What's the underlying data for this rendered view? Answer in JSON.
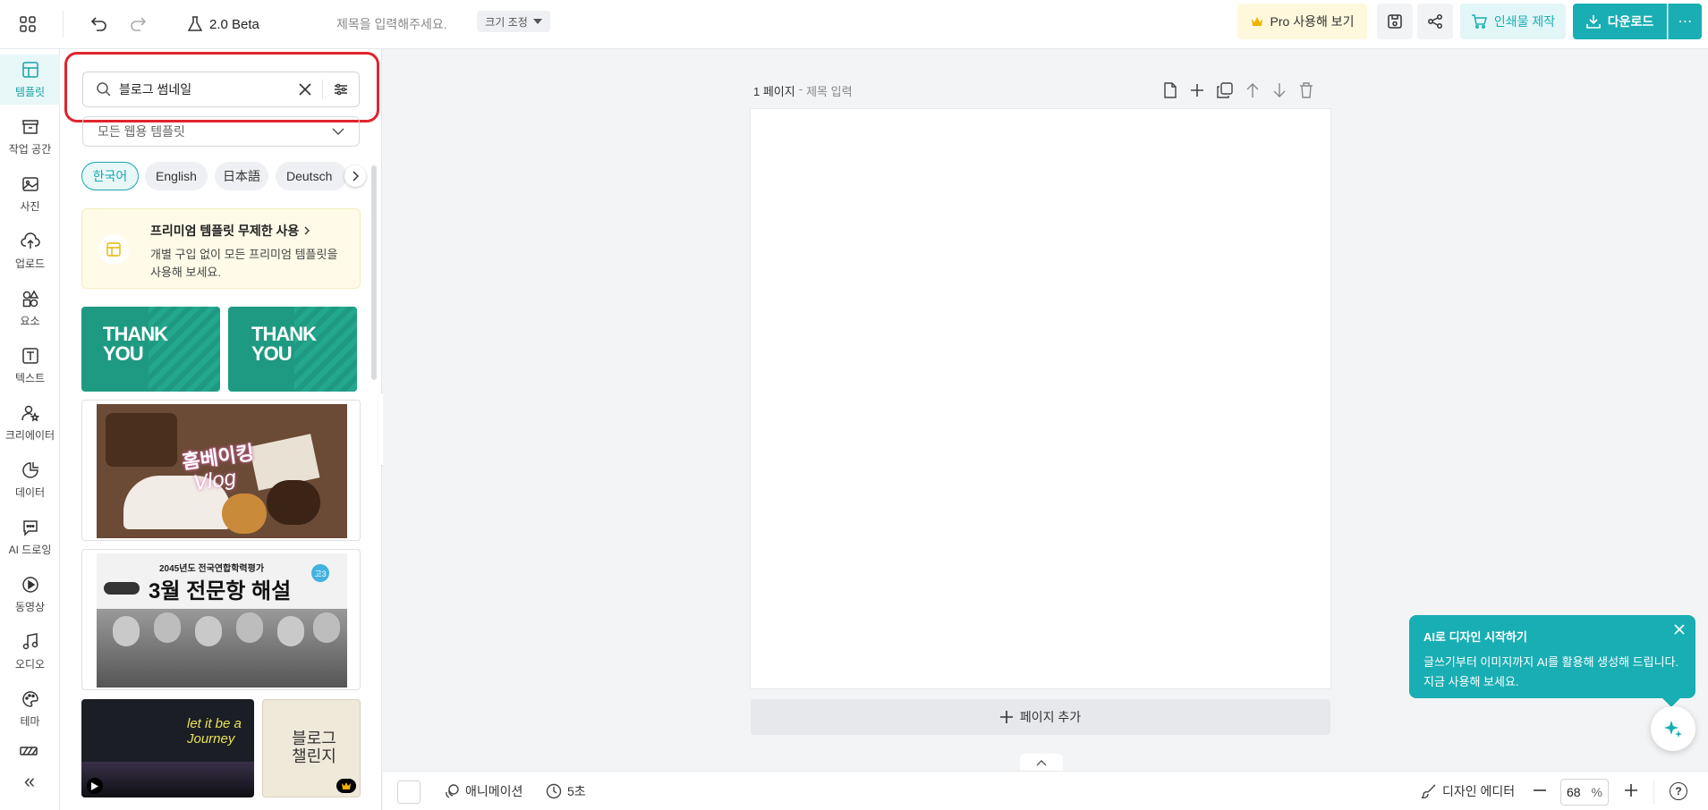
{
  "header": {
    "version": "2.0 Beta",
    "title_placeholder": "제목을 입력해주세요.",
    "resize_label": "크기 조정",
    "pro_label": "Pro 사용해 보기",
    "print_label": "인쇄물 제작",
    "download_label": "다운로드",
    "more_label": "⋯"
  },
  "sidebar": {
    "items": [
      {
        "label": "템플릿",
        "icon": "template-icon"
      },
      {
        "label": "작업 공간",
        "icon": "archive-icon"
      },
      {
        "label": "사진",
        "icon": "photo-icon"
      },
      {
        "label": "업로드",
        "icon": "upload-icon"
      },
      {
        "label": "요소",
        "icon": "shapes-icon"
      },
      {
        "label": "텍스트",
        "icon": "text-icon"
      },
      {
        "label": "크리에이터",
        "icon": "creator-icon"
      },
      {
        "label": "데이터",
        "icon": "chart-icon"
      },
      {
        "label": "AI 드로잉",
        "icon": "ai-chat-icon"
      },
      {
        "label": "동영상",
        "icon": "play-icon"
      },
      {
        "label": "오디오",
        "icon": "music-icon"
      },
      {
        "label": "테마",
        "icon": "palette-icon"
      }
    ],
    "collapse": "«"
  },
  "panel": {
    "search_value": "블로그 썸네일",
    "dropdown_value": "모든 웹용 템플릿",
    "languages": [
      "한국어",
      "English",
      "日本語",
      "Deutsch"
    ],
    "promo_title": "프리미엄 템플릿 무제한 사용",
    "promo_line1": "개별 구입 없이 모든 프리미엄 템플릿을",
    "promo_line2": "사용해 보세요.",
    "thumb1_text1": "THANK",
    "thumb1_text2": "YOU",
    "thumb2_text1": "THANK",
    "thumb2_text2": "YOU",
    "vlog_text1": "홈베이킹",
    "vlog_text2": "Vlog",
    "exam_header": "2045년도 전국연합학력평가",
    "exam_title": "3월 전문항 해설",
    "exam_badge": "고3",
    "journey_text": "let it be a Journey",
    "challenge_text": "블로그 챌린지"
  },
  "canvas": {
    "page_label": "1 페이지",
    "page_title_placeholder": "제목 입력",
    "add_page": "페이지 추가"
  },
  "toast": {
    "title": "AI로 디자인 시작하기",
    "line1": "글쓰기부터 이미지까지 AI를 활용해 생성해 드립니다.",
    "line2": "지금 사용해 보세요."
  },
  "bottom": {
    "animation": "애니메이션",
    "duration": "5초",
    "design_editor": "디자인 에디터",
    "zoom": "68",
    "zoom_unit": "%",
    "help": "?"
  },
  "colors": {
    "accent": "#19aeb4",
    "danger": "#e0242c",
    "promo_bg": "#fffbe8"
  }
}
